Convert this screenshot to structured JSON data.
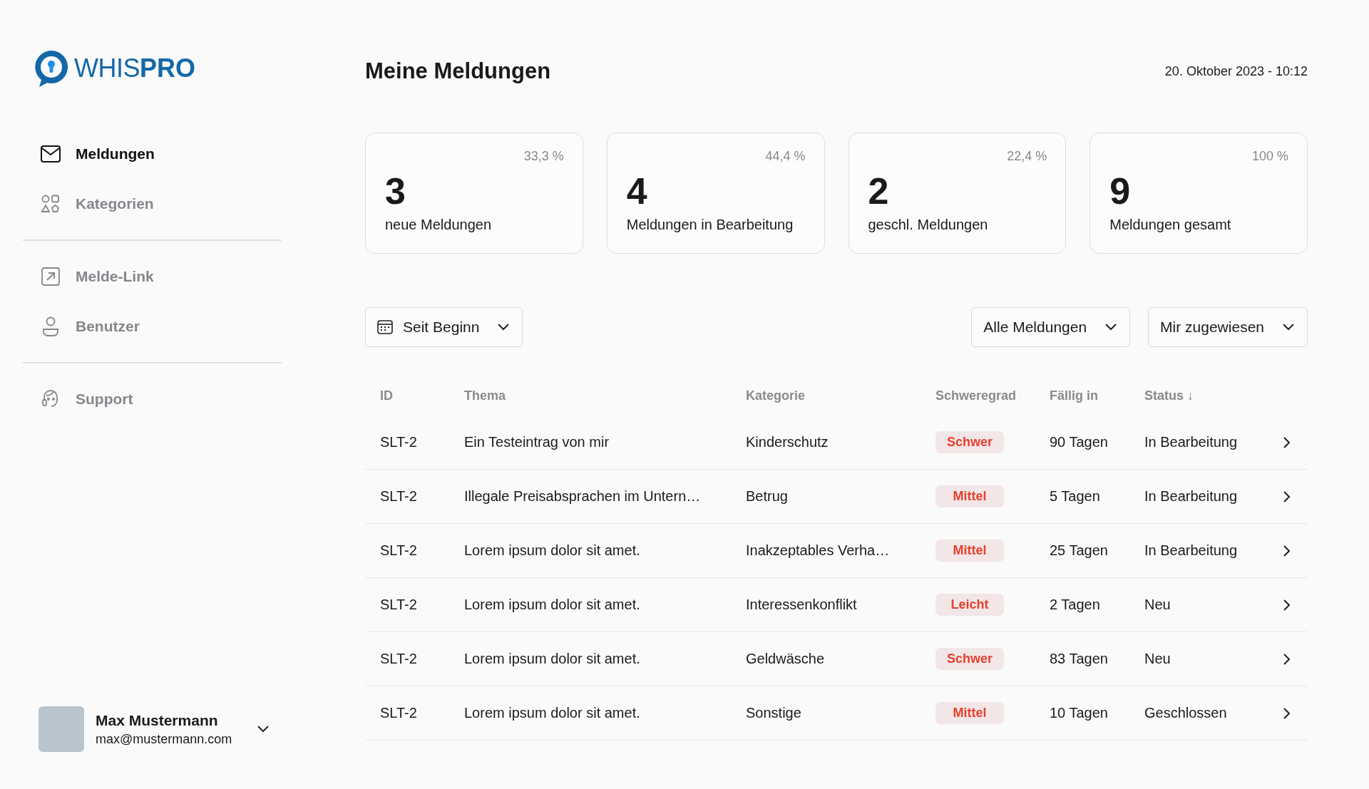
{
  "logo": {
    "light": "WHIS",
    "bold": "PRO"
  },
  "sidebar": {
    "groups": [
      [
        {
          "label": "Meldungen",
          "kind": "mail",
          "selected": true
        },
        {
          "label": "Kategorien",
          "kind": "shapes",
          "selected": false
        }
      ],
      [
        {
          "label": "Melde-Link",
          "kind": "link",
          "selected": false
        },
        {
          "label": "Benutzer",
          "kind": "user",
          "selected": false
        }
      ],
      [
        {
          "label": "Support",
          "kind": "support",
          "selected": false
        }
      ]
    ]
  },
  "user": {
    "name": "Max Mustermann",
    "email": "max@mustermann.com"
  },
  "header": {
    "title": "Meine Meldungen",
    "datetime": "20. Oktober 2023 - 10:12"
  },
  "stats": [
    {
      "percent": "33,3 %",
      "count": "3",
      "label": "neue Meldungen"
    },
    {
      "percent": "44,4 %",
      "count": "4",
      "label": "Meldungen in Bearbeitung"
    },
    {
      "percent": "22,4 %",
      "count": "2",
      "label": "geschl. Meldungen"
    },
    {
      "percent": "100 %",
      "count": "9",
      "label": "Meldungen gesamt"
    }
  ],
  "filters": {
    "period": "Seit Beginn",
    "type": "Alle Meldungen",
    "assignee": "Mir zugewiesen"
  },
  "table": {
    "columns": [
      "ID",
      "Thema",
      "Kategorie",
      "Schweregrad",
      "Fällig in",
      "Status"
    ],
    "sort_indicator": "↓",
    "rows": [
      {
        "id": "SLT-2",
        "topic": "Ein Testeintrag von mir",
        "category": "Kinderschutz",
        "severity": "Schwer",
        "due": "90 Tagen",
        "status": "In Bearbeitung"
      },
      {
        "id": "SLT-2",
        "topic": "Illegale Preisabsprachen im Untern…",
        "category": "Betrug",
        "severity": "Mittel",
        "due": "5 Tagen",
        "status": "In Bearbeitung"
      },
      {
        "id": "SLT-2",
        "topic": "Lorem ipsum dolor sit amet.",
        "category": "Inakzeptables Verha…",
        "severity": "Mittel",
        "due": "25 Tagen",
        "status": "In Bearbeitung"
      },
      {
        "id": "SLT-2",
        "topic": "Lorem ipsum dolor sit amet.",
        "category": "Interessenkonflikt",
        "severity": "Leicht",
        "due": "2 Tagen",
        "status": "Neu"
      },
      {
        "id": "SLT-2",
        "topic": "Lorem ipsum dolor sit amet.",
        "category": "Geldwäsche",
        "severity": "Schwer",
        "due": "83 Tagen",
        "status": "Neu"
      },
      {
        "id": "SLT-2",
        "topic": "Lorem ipsum dolor sit amet.",
        "category": "Sonstige",
        "severity": "Mittel",
        "due": "10 Tagen",
        "status": "Geschlossen"
      }
    ]
  }
}
